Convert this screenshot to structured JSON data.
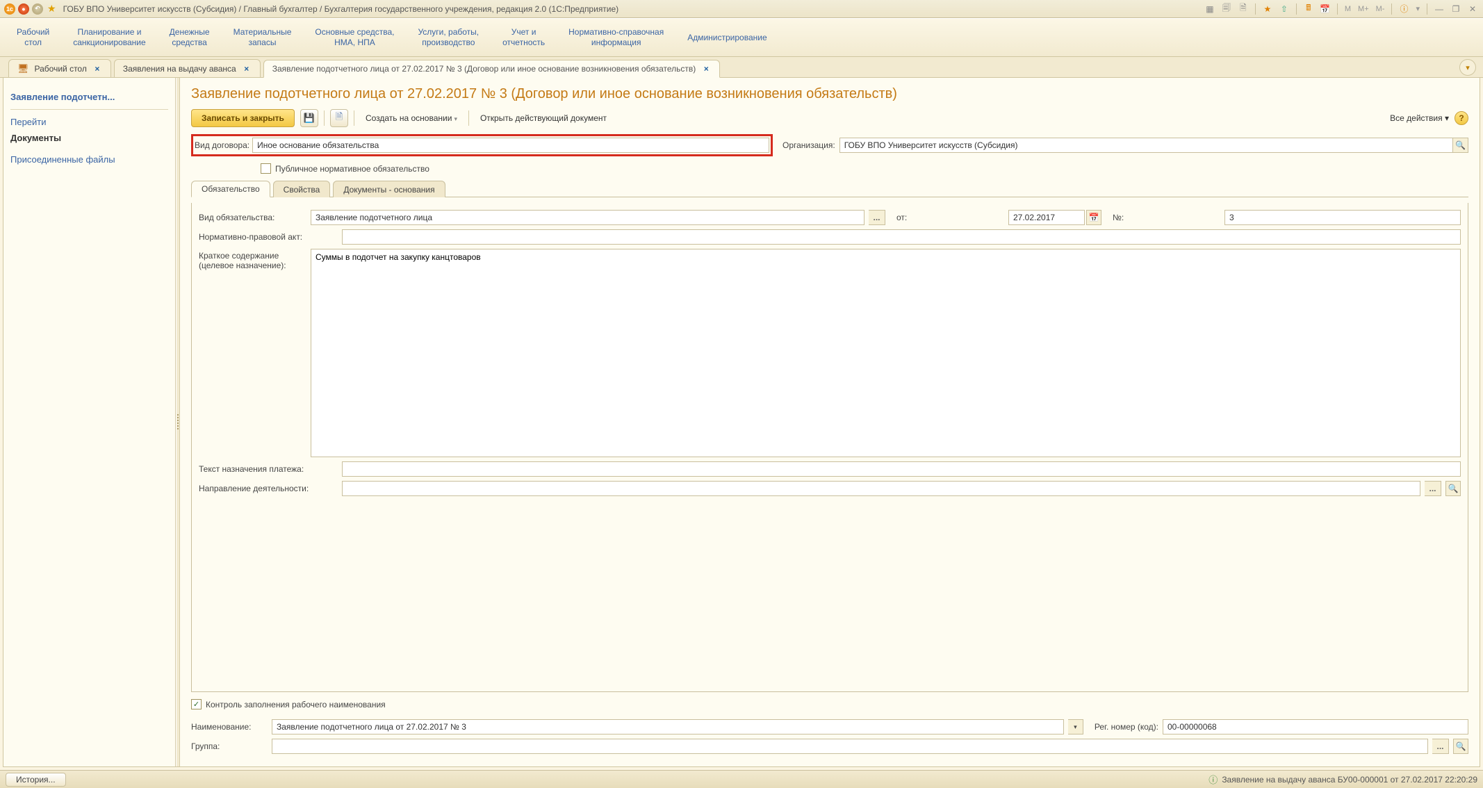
{
  "title": "ГОБУ ВПО Университет искусств (Субсидия) / Главный бухгалтер / Бухгалтерия государственного учреждения, редакция 2.0  (1С:Предприятие)",
  "mainnav": [
    "Рабочий\nстол",
    "Планирование и\nсанкционирование",
    "Денежные\nсредства",
    "Материальные\nзапасы",
    "Основные средства,\nНМА, НПА",
    "Услуги, работы,\nпроизводство",
    "Учет и\nотчетность",
    "Нормативно-справочная\nинформация",
    "Администрирование"
  ],
  "tabs": [
    {
      "label": "Рабочий стол"
    },
    {
      "label": "Заявления на выдачу аванса"
    },
    {
      "label": "Заявление подотчетного лица от 27.02.2017 № 3 (Договор или иное основание возникновения обязательств)"
    }
  ],
  "sidebar": {
    "active": "Заявление подотчетн...",
    "goto": "Перейти",
    "documents": "Документы",
    "attached": "Присоединенные файлы"
  },
  "doc": {
    "title": "Заявление подотчетного лица от 27.02.2017 № 3 (Договор или иное основание возникновения обязательств)",
    "toolbar": {
      "save_close": "Записать и закрыть",
      "create_based": "Создать на основании",
      "open_active": "Открыть действующий документ",
      "all_actions": "Все действия"
    },
    "fields": {
      "contract_type_label": "Вид договора:",
      "contract_type_value": "Иное основание обязательства",
      "org_label": "Организация:",
      "org_value": "ГОБУ ВПО Университет искусств (Субсидия)",
      "public_norm": "Публичное нормативное обязательство"
    }
  },
  "dtabs": [
    "Обязательство",
    "Свойства",
    "Документы - основания"
  ],
  "detail": {
    "type_label": "Вид обязательства:",
    "type_value": "Заявление подотчетного лица",
    "date_prefix": "от:",
    "date_value": "27.02.2017",
    "num_prefix": "№:",
    "num_value": "3",
    "npa_label": "Нормативно-правовой акт:",
    "npa_value": "",
    "summary_label": "Краткое содержание\n(целевое назначение):",
    "summary_value": "Суммы в подотчет на закупку канцтоваров",
    "pay_text_label": "Текст назначения платежа:",
    "pay_text_value": "",
    "activity_label": "Направление деятельности:",
    "activity_value": "",
    "control_label": "Контроль заполнения рабочего наименования",
    "name_label": "Наименование:",
    "name_value": "Заявление подотчетного лица от 27.02.2017 № 3",
    "regnum_label": "Рег. номер (код):",
    "regnum_value": "00-00000068",
    "group_label": "Группа:",
    "group_value": ""
  },
  "status": {
    "history": "История...",
    "info": "Заявление на выдачу аванса БУ00-000001 от 27.02.2017 22:20:29"
  },
  "memory": {
    "m": "M",
    "mp": "M+",
    "mm": "M-"
  }
}
